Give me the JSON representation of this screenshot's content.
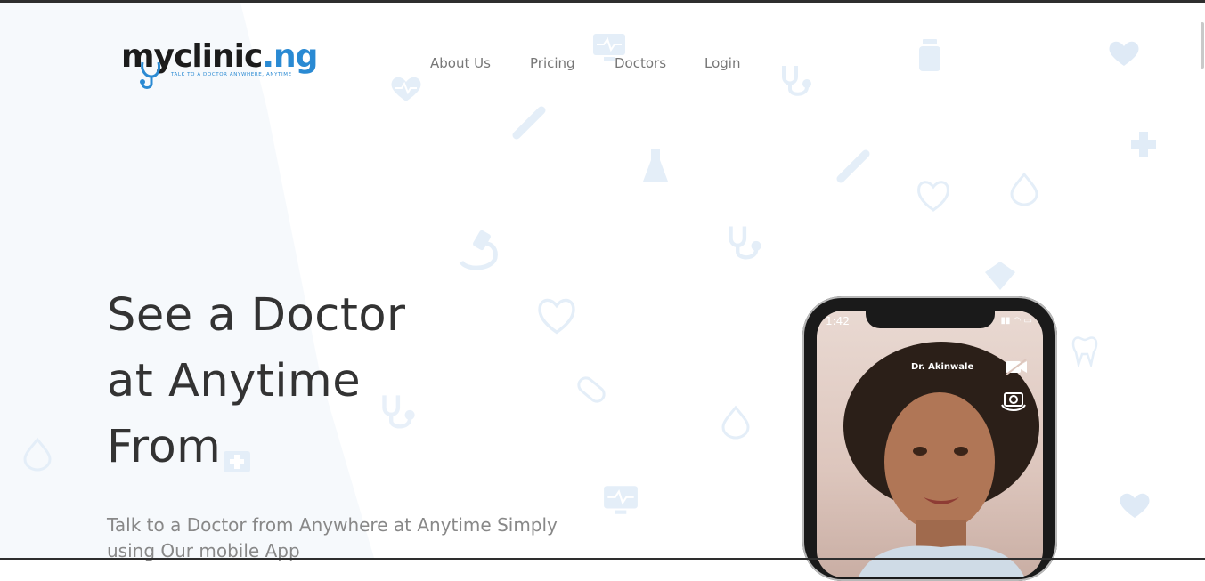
{
  "brand": {
    "logo_main": "myclinic",
    "logo_suffix": ".ng",
    "tagline": "TALK TO A DOCTOR ANYWHERE, ANYTIME"
  },
  "nav": {
    "items": [
      {
        "label": "About Us"
      },
      {
        "label": "Pricing"
      },
      {
        "label": "Doctors"
      },
      {
        "label": "Login"
      }
    ]
  },
  "hero": {
    "title_lines": [
      "See a Doctor",
      "at Anytime",
      "From"
    ],
    "subtitle": "Talk to a Doctor from Anywhere at Anytime Simply using Our mobile App"
  },
  "phone": {
    "time": "1:42",
    "doctor_name": "Dr. Akinwale"
  },
  "colors": {
    "accent": "#2a8ad3",
    "text_dark": "#333333",
    "text_muted": "#888888",
    "deco_icons": "#dbe8f5"
  },
  "icons": [
    "stethoscope-icon",
    "heart-icon",
    "thermometer-icon",
    "flask-icon",
    "microscope-icon",
    "pill-icon",
    "drop-icon",
    "tooth-icon",
    "plus-icon",
    "bottle-icon",
    "monitor-icon",
    "video-camera-icon",
    "flip-camera-icon"
  ]
}
